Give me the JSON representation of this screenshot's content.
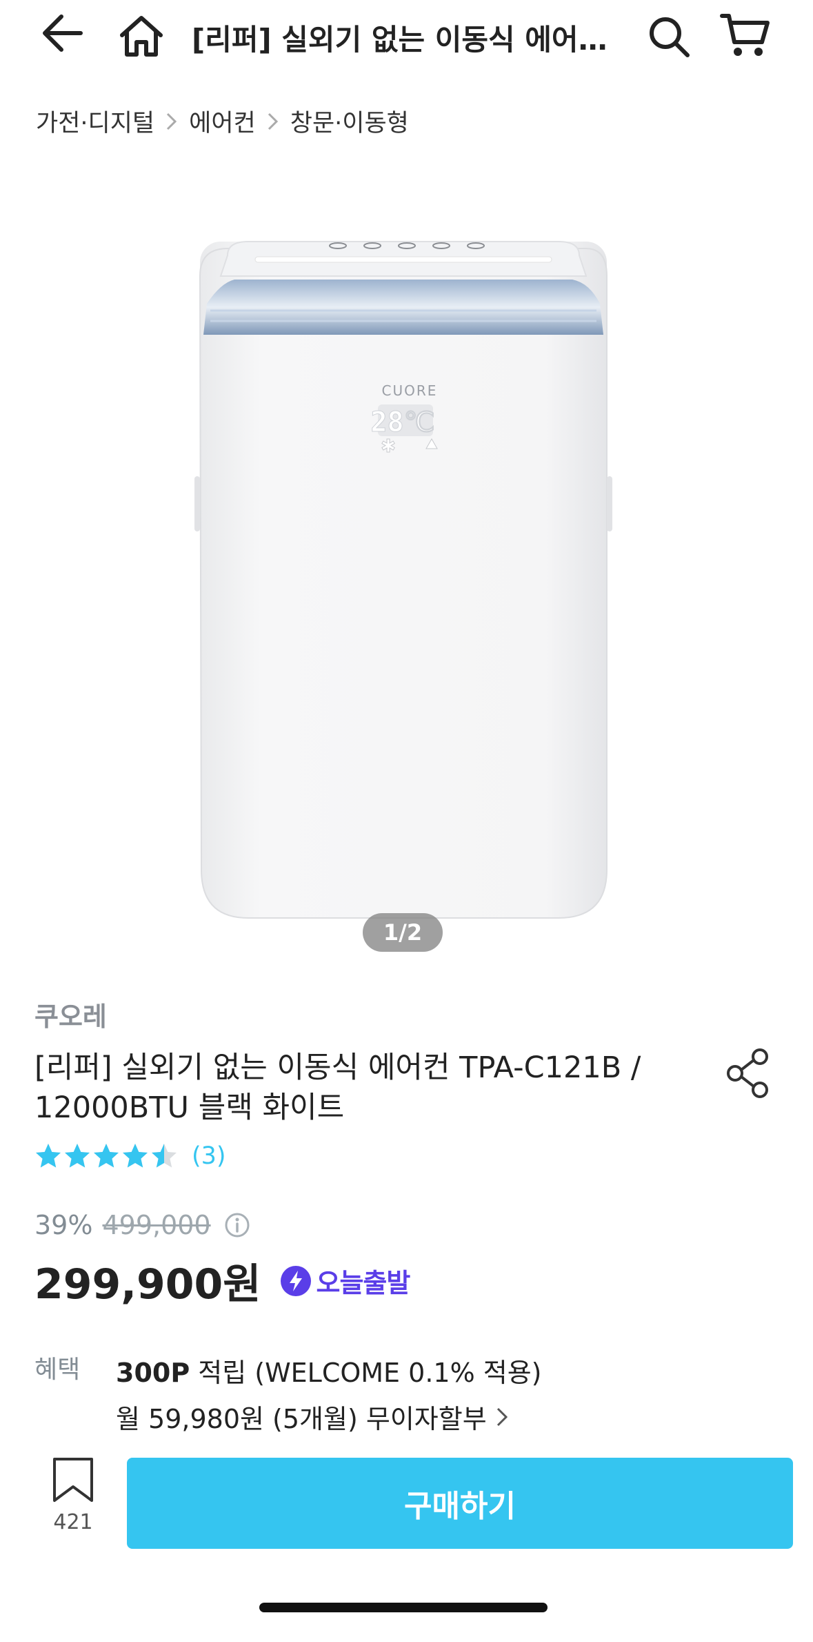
{
  "header": {
    "title": "[리퍼] 실외기 없는 이동식 에어컨 TPA-C121B / 12000BTU 블랙 화이트",
    "icons": [
      "arrow-left-icon",
      "home-icon",
      "search-icon",
      "cart-icon"
    ]
  },
  "breadcrumb": [
    "가전·디지털",
    "에어컨",
    "창문·이동형"
  ],
  "image": {
    "pager": "1/2",
    "device_brand_text": "CUORE",
    "device_display_temp": "28℃"
  },
  "product": {
    "brand": "쿠오레",
    "title": "[리퍼] 실외기 없는 이동식 에어컨 TPA-C121B / 12000BTU 블랙 화이트",
    "rating": 4.5,
    "review_count": "(3)",
    "discount": "39%",
    "original_price": "499,000",
    "price": "299,900원",
    "delivery_badge": "오늘출발"
  },
  "benefit": {
    "label": "혜택",
    "points_bold": "300P",
    "points_rest": " 적립 (WELCOME 0.1% 적용)",
    "installment": "월 59,980원 (5개월) 무이자할부"
  },
  "bottom": {
    "bookmark_count": "421",
    "buy_label": "구매하기"
  },
  "colors": {
    "accent": "#35c5f0",
    "badge": "#5a3ee8",
    "muted": "#828c94"
  }
}
